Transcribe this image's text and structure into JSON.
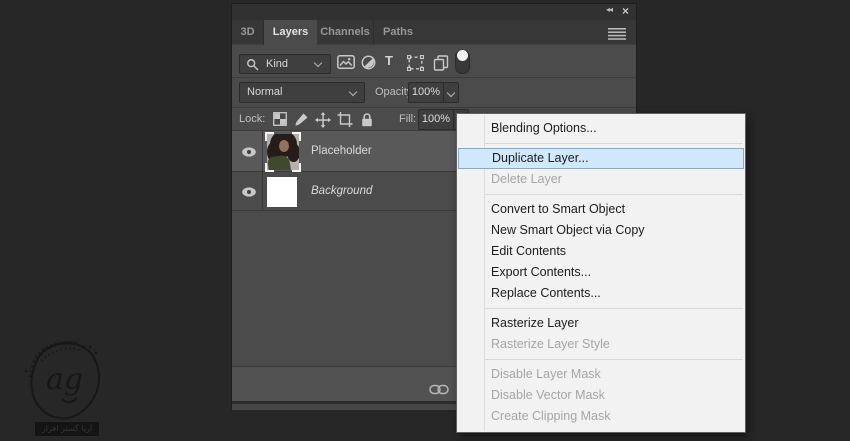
{
  "panel": {
    "window_controls": {
      "collapse_glyph": "◂◂",
      "close_glyph": "×"
    },
    "tabs": [
      {
        "label": "3D",
        "active": false
      },
      {
        "label": "Layers",
        "active": true
      },
      {
        "label": "Channels",
        "active": false
      },
      {
        "label": "Paths",
        "active": false
      }
    ],
    "filter_row": {
      "kind_label": "Kind",
      "type_glyph": "T"
    },
    "blend_row": {
      "blend_mode": "Normal",
      "opacity_label": "Opacity:",
      "opacity_value": "100%"
    },
    "lock_row": {
      "lock_label": "Lock:",
      "fill_label": "Fill:",
      "fill_value": "100%"
    },
    "layers": [
      {
        "name": "Placeholder",
        "selected": true,
        "visible": true,
        "thumbnail": "portrait-photo"
      },
      {
        "name": "Background",
        "selected": false,
        "visible": true,
        "thumbnail": "white-fill",
        "italic": true
      }
    ]
  },
  "context_menu": {
    "items": [
      {
        "label": "Blending Options...",
        "state": "enabled"
      },
      {
        "type": "separator"
      },
      {
        "label": "Duplicate Layer...",
        "state": "highlighted"
      },
      {
        "label": "Delete Layer",
        "state": "disabled"
      },
      {
        "type": "separator"
      },
      {
        "label": "Convert to Smart Object",
        "state": "enabled"
      },
      {
        "label": "New Smart Object via Copy",
        "state": "enabled"
      },
      {
        "label": "Edit Contents",
        "state": "enabled"
      },
      {
        "label": "Export Contents...",
        "state": "enabled"
      },
      {
        "label": "Replace Contents...",
        "state": "enabled"
      },
      {
        "type": "separator"
      },
      {
        "label": "Rasterize Layer",
        "state": "enabled"
      },
      {
        "label": "Rasterize Layer Style",
        "state": "disabled"
      },
      {
        "type": "separator"
      },
      {
        "label": "Disable Layer Mask",
        "state": "disabled"
      },
      {
        "label": "Disable Vector Mask",
        "state": "disabled"
      },
      {
        "label": "Create Clipping Mask",
        "state": "disabled"
      }
    ]
  },
  "watermark": {
    "logo_letters": "ag",
    "text": "آریا گستر افزار"
  },
  "colors": {
    "background": "#272727",
    "panel_body": "#4b4b4b",
    "panel_titlebar": "#313131",
    "selected_row": "#595959",
    "menu_background": "#f2f2f2",
    "menu_highlight_fill": "#cfe8fb",
    "menu_highlight_border": "#84aad0",
    "menu_disabled_text": "#a5a5a5"
  }
}
